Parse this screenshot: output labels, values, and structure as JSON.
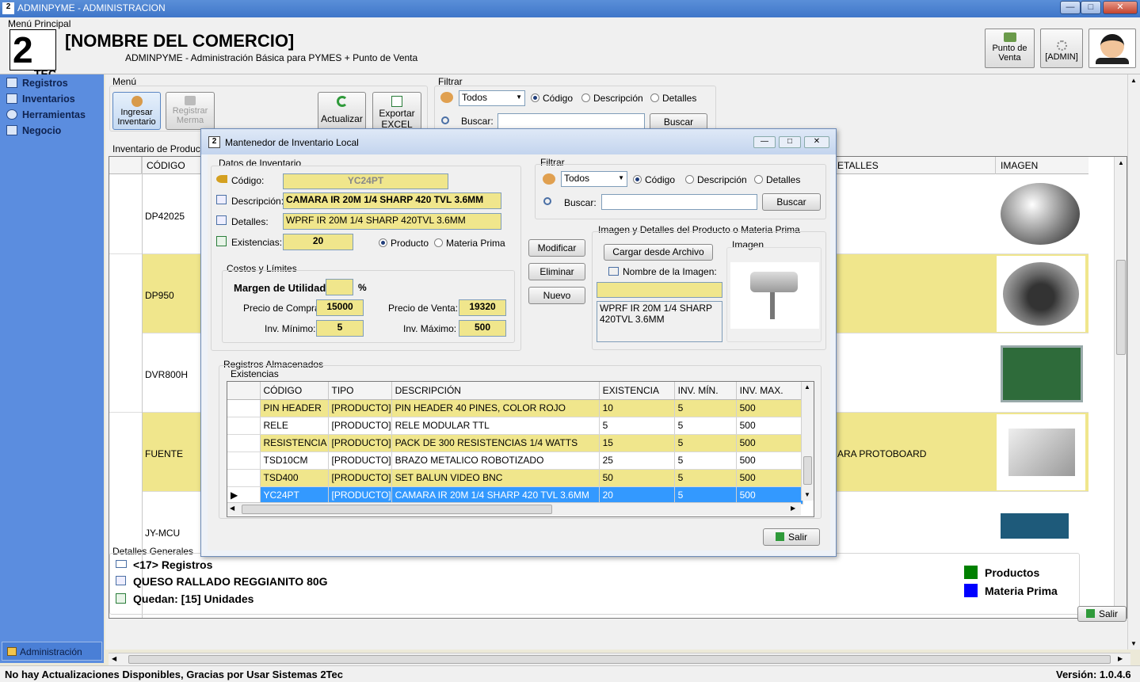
{
  "window": {
    "title": "ADMINPYME - ADMINISTRACION",
    "min": "—",
    "max": "□",
    "close": "✕"
  },
  "header": {
    "menu_label": "Menú Principal",
    "logo_main": "2",
    "logo_sub": "TEC",
    "business_name": "[NOMBRE DEL COMERCIO]",
    "subtitle": "ADMINPYME - Administración Básica para PYMES + Punto de Venta",
    "pos_button": "Punto de Venta",
    "admin_button": "[ADMIN]"
  },
  "sidebar": {
    "items": [
      {
        "label": "Registros",
        "icon": "registros-icon"
      },
      {
        "label": "Inventarios",
        "icon": "inventarios-icon"
      },
      {
        "label": "Herramientas",
        "icon": "herramientas-icon"
      },
      {
        "label": "Negocio",
        "icon": "negocio-icon"
      }
    ],
    "admin_label": "Administración"
  },
  "menu_group": {
    "title": "Menú",
    "ingresar": "Ingresar Inventario",
    "registrar": "Registrar Merma",
    "actualizar": "Actualizar",
    "exportar": "Exportar EXCEL"
  },
  "main_filter": {
    "title": "Filtrar",
    "select_value": "Todos",
    "radio_codigo": "Código",
    "radio_descripcion": "Descripción",
    "radio_detalles": "Detalles",
    "search_label": "Buscar:",
    "search_button": "Buscar"
  },
  "inventory": {
    "title": "Inventario de Productos",
    "col_codigo": "CÓDIGO",
    "col_detalles": "ETALLES",
    "col_imagen": "IMAGEN",
    "rows": [
      {
        "code": "DP42025",
        "detail": "",
        "highlight": false
      },
      {
        "code": "DP950",
        "detail": "",
        "highlight": true
      },
      {
        "code": "DVR800H",
        "detail": "",
        "highlight": false
      },
      {
        "code": "FUENTE",
        "detail": "ARA PROTOBOARD",
        "highlight": true
      },
      {
        "code": "JY-MCU",
        "detail": "",
        "highlight": false
      }
    ]
  },
  "dialog": {
    "title": "Mantenedor de Inventario Local",
    "datos_title": "Datos de Inventario",
    "codigo_label": "Código:",
    "codigo_value": "YC24PT",
    "descripcion_label": "Descripción:",
    "descripcion_value": "CAMARA IR 20M 1/4 SHARP 420 TVL 3.6MM",
    "detalles_label": "Detalles:",
    "detalles_value": "WPRF IR 20M 1/4 SHARP 420TVL 3.6MM",
    "existencias_label": "Existencias:",
    "existencias_value": "20",
    "radio_producto": "Producto",
    "radio_materia": "Materia Prima",
    "costos_title": "Costos y Límites",
    "margen_label": "Margen de Utilidad:",
    "margen_value": "",
    "percent": "%",
    "compra_label": "Precio de Compra:",
    "compra_value": "15000",
    "venta_label": "Precio de Venta:",
    "venta_value": "19320",
    "min_label": "Inv. Mínimo:",
    "min_value": "5",
    "max_label": "Inv. Máximo:",
    "max_value": "500",
    "filter_title": "Filtrar",
    "filter_select": "Todos",
    "filter_codigo": "Código",
    "filter_descripcion": "Descripción",
    "filter_detalles": "Detalles",
    "filter_buscar_label": "Buscar:",
    "filter_buscar_button": "Buscar",
    "modificar": "Modificar",
    "eliminar": "Eliminar",
    "nuevo": "Nuevo",
    "img_group_title": "Imagen y Detalles del Producto o Materia Prima",
    "cargar": "Cargar desde Archivo",
    "nombre_imagen_label": "Nombre de la Imagen:",
    "nombre_imagen_value": "",
    "img_detail_text": "WPRF IR 20M 1/4 SHARP 420TVL 3.6MM",
    "imagen_label": "Imagen",
    "registros_title": "Registros Almacenados",
    "existencias_sub": "Existencias",
    "salir": "Salir",
    "grid_headers": [
      "CÓDIGO",
      "TIPO",
      "DESCRIPCIÓN",
      "EXISTENCIA",
      "INV. MÍN.",
      "INV. MAX."
    ],
    "grid_rows": [
      {
        "codigo": "PIN HEADER",
        "tipo": "[PRODUCTO]",
        "descripcion": "PIN HEADER 40 PINES, COLOR ROJO",
        "existencia": "10",
        "min": "5",
        "max": "500",
        "style": "yellow"
      },
      {
        "codigo": "RELE",
        "tipo": "[PRODUCTO]",
        "descripcion": "RELE MODULAR TTL",
        "existencia": "5",
        "min": "5",
        "max": "500",
        "style": "white"
      },
      {
        "codigo": "RESISTENCIA",
        "tipo": "[PRODUCTO]",
        "descripcion": "PACK DE 300 RESISTENCIAS 1/4 WATTS",
        "existencia": "15",
        "min": "5",
        "max": "500",
        "style": "yellow"
      },
      {
        "codigo": "TSD10CM",
        "tipo": "[PRODUCTO]",
        "descripcion": "BRAZO METALICO ROBOTIZADO",
        "existencia": "25",
        "min": "5",
        "max": "500",
        "style": "white"
      },
      {
        "codigo": "TSD400",
        "tipo": "[PRODUCTO]",
        "descripcion": "SET BALUN VIDEO BNC",
        "existencia": "50",
        "min": "5",
        "max": "500",
        "style": "yellow"
      },
      {
        "codigo": "YC24PT",
        "tipo": "[PRODUCTO]",
        "descripcion": "CAMARA IR 20M 1/4 SHARP 420 TVL 3.6MM",
        "existencia": "20",
        "min": "5",
        "max": "500",
        "style": "selected"
      }
    ]
  },
  "details": {
    "title": "Detalles Generales",
    "registros": "<17> Registros",
    "product": "QUESO RALLADO REGGIANITO 80G",
    "quedan": "Quedan: [15] Unidades",
    "legend_productos": "Productos",
    "legend_materia": "Materia Prima",
    "color_productos": "#008000",
    "color_materia": "#0000ff",
    "salir": "Salir"
  },
  "status": {
    "message": "No hay Actualizaciones Disponibles, Gracias por Usar Sistemas 2Tec",
    "version": "Versión:  1.0.4.6"
  }
}
